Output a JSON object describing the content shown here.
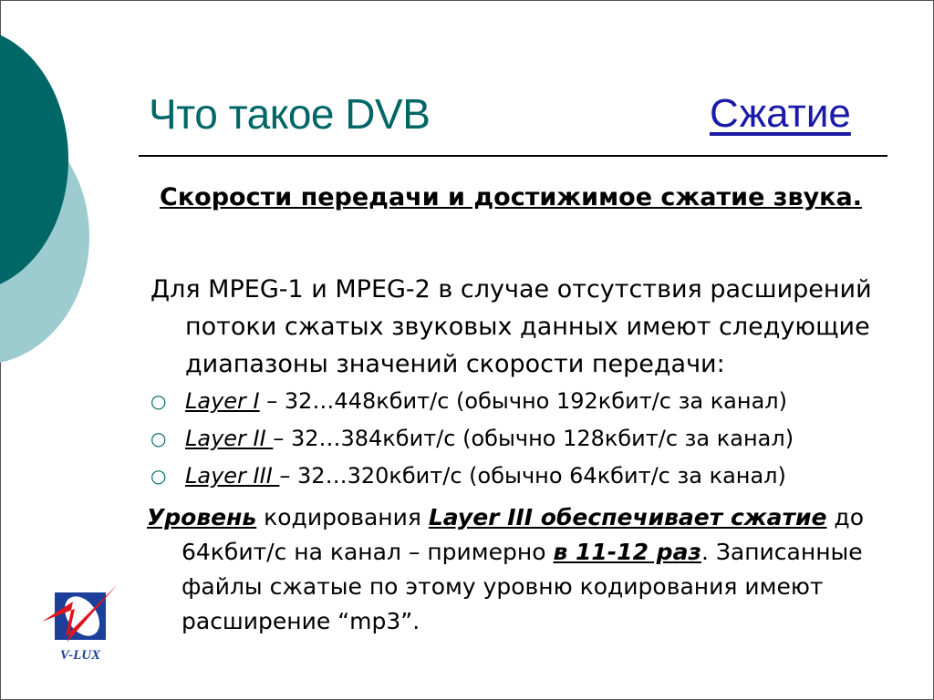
{
  "slide": {
    "title": "Что такое DVB",
    "section_link": "Сжатие",
    "subtitle": "Скорости передачи и достижимое сжатие звука.",
    "intro": "Для MPEG-1 и MPEG-2 в случае отсутствия расширений потоки сжатых звуковых данных имеют следующие диапазоны значений скорости передачи:",
    "bullets": [
      {
        "layer": "Layer I",
        "text": " – 32…448кбит/с (обычно 192кбит/с за канал)"
      },
      {
        "layer": "Layer II ",
        "text": "– 32…384кбит/с (обычно 128кбит/с за канал)"
      },
      {
        "layer": "Layer III ",
        "text": "– 32…320кбит/с (обычно 64кбит/с за канал)"
      }
    ],
    "conclusion": {
      "p1": "Уровень",
      "p2": " кодирования ",
      "p3": "Layer III  обеспечивает сжатие",
      "p4": " до 64кбит/с на канал – примерно ",
      "p5": "в 11-12 раз",
      "p6": ". Записанные файлы сжатые по этому уровню кодирования имеют расширение “mp3”."
    },
    "logo_text": "V-LUX",
    "colors": {
      "accent": "#006666",
      "accent_light": "#9ccccf",
      "link": "#1a1aa6",
      "logo_blue": "#1c3f9a",
      "logo_red": "#e0141e"
    }
  }
}
